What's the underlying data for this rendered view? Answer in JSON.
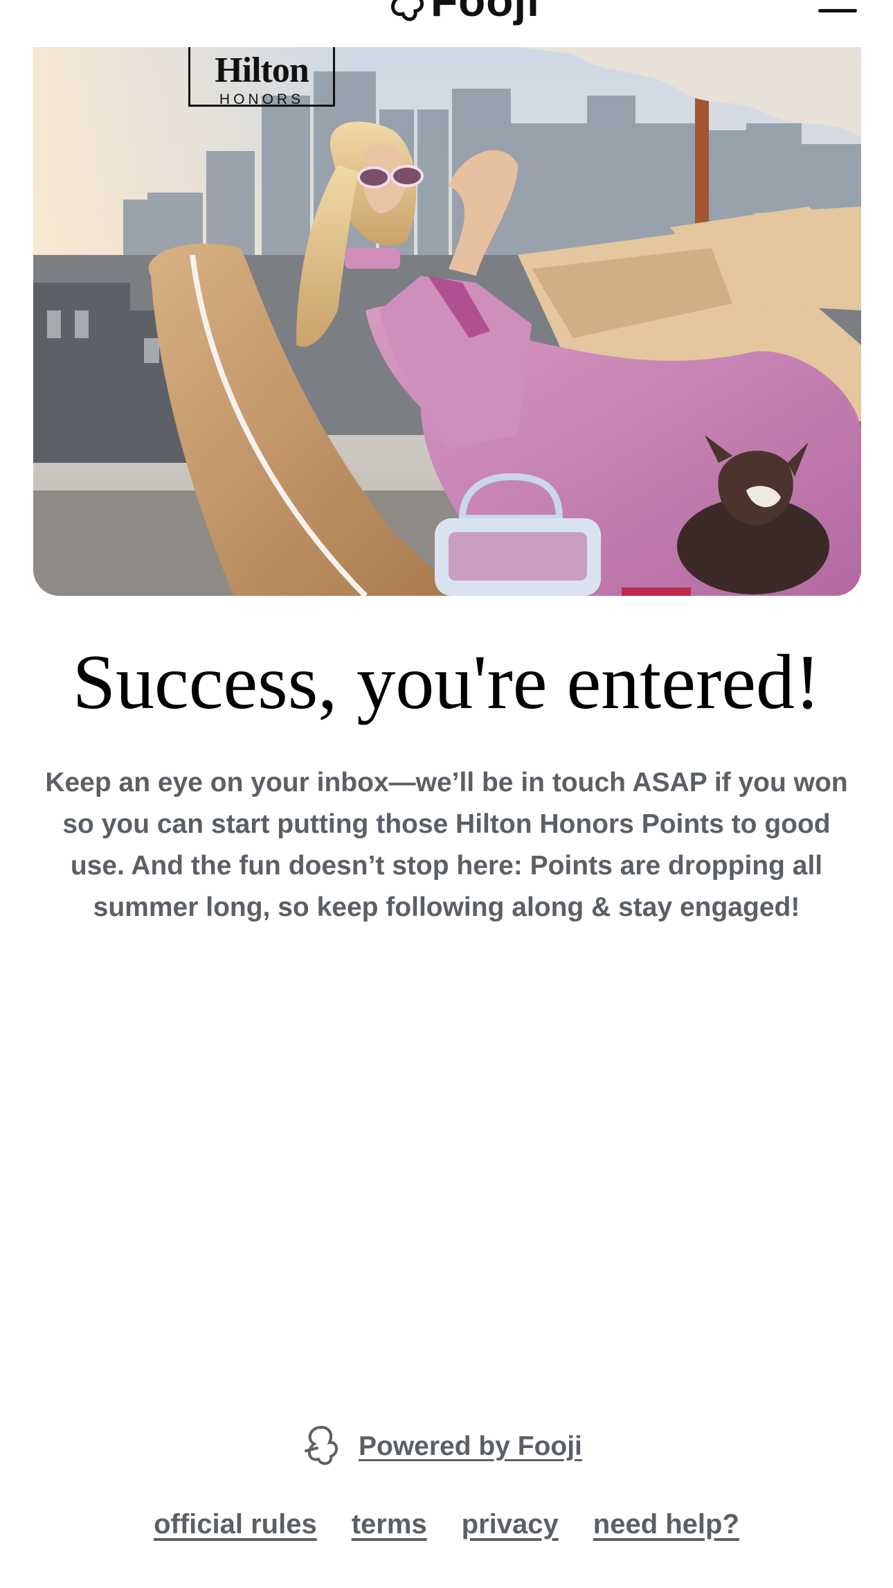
{
  "header": {
    "brand_name": "Fooji",
    "menu_icon": "hamburger-menu-icon"
  },
  "hero": {
    "badge": {
      "name": "Hilton",
      "tier": "HONORS"
    }
  },
  "main": {
    "headline": "Success, you're entered!",
    "message": "Keep an eye on your inbox—we’ll be in touch ASAP if you won so you can start putting those Hilton Honors Points to good use. And the fun doesn’t stop here: Points are dropping all summer long, so keep following along & stay engaged!"
  },
  "footer": {
    "powered_by": "Powered by Fooji",
    "powered_icon": "fooji-logo-icon",
    "links": [
      "official rules",
      "terms",
      "privacy",
      "need help?"
    ]
  },
  "colors": {
    "text_primary": "#000000",
    "text_secondary": "#5b5f66",
    "background": "#ffffff"
  }
}
